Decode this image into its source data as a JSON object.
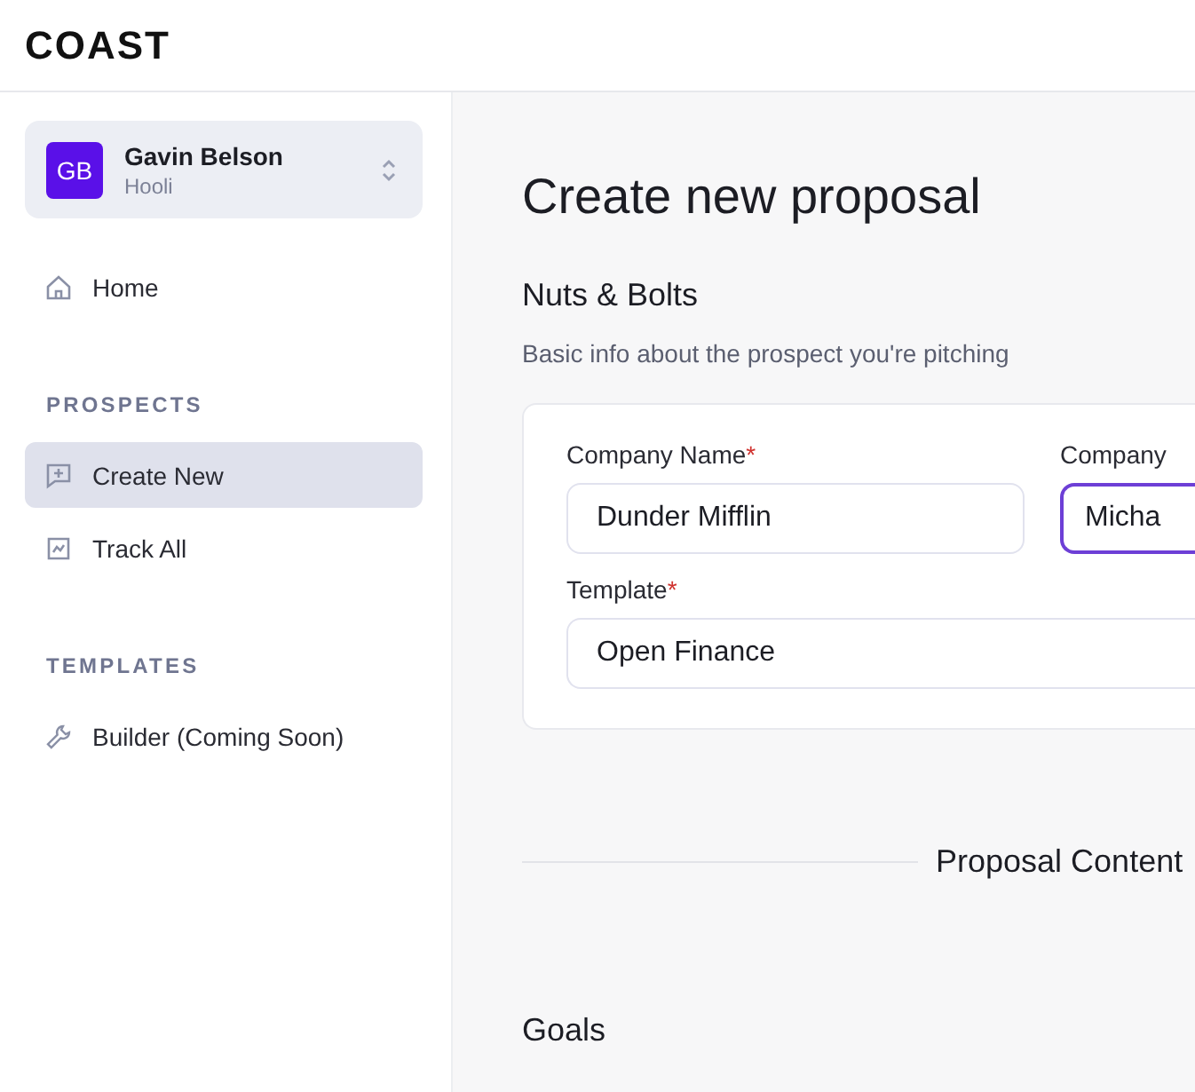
{
  "logo": "COAST",
  "account": {
    "initials": "GB",
    "name": "Gavin Belson",
    "org": "Hooli"
  },
  "nav": [
    {
      "kind": "item",
      "label": "Home",
      "selected": false
    },
    {
      "kind": "heading",
      "label": "PROSPECTS"
    },
    {
      "kind": "item",
      "label": "Create New",
      "selected": true
    },
    {
      "kind": "item",
      "label": "Track All",
      "selected": false
    },
    {
      "kind": "heading",
      "label": "TEMPLATES"
    },
    {
      "kind": "item",
      "label": "Builder (Coming Soon)",
      "selected": false
    }
  ],
  "page_title": "Create new proposal",
  "section": {
    "title": "Nuts & Bolts",
    "subtitle": "Basic info about the prospect you're pitching"
  },
  "fields": [
    {
      "label": "Company Name",
      "asterisk": "*",
      "value": "Dunder Mifflin",
      "focused": false
    },
    {
      "label": "Company",
      "value": "Micha",
      "focused": true
    },
    {
      "label": "Template",
      "asterisk": "*",
      "value": "Open Finance",
      "focused": false
    }
  ],
  "divider_label": "Proposal Content",
  "next_section": "Goals"
}
